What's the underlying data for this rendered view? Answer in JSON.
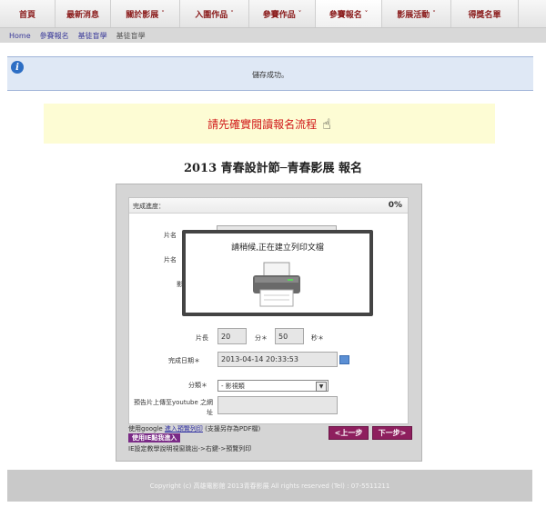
{
  "nav": {
    "items": [
      {
        "label": "首頁",
        "caret": ""
      },
      {
        "label": "最新消息",
        "caret": ""
      },
      {
        "label": "關於影展",
        "caret": "˅"
      },
      {
        "label": "入圍作品",
        "caret": "˅"
      },
      {
        "label": "參賽作品",
        "caret": "˅"
      },
      {
        "label": "參賽報名",
        "caret": "˅"
      },
      {
        "label": "影展活動",
        "caret": "˅"
      },
      {
        "label": "得獎名單",
        "caret": ""
      }
    ]
  },
  "subnav": {
    "items": [
      "Home",
      "參賽報名",
      "基徒盲學",
      "基徒盲學"
    ]
  },
  "info": {
    "icon": "info-icon",
    "message": "儲存成功。"
  },
  "notice": {
    "text": "請先確實閱讀報名流程"
  },
  "page_title": "2013 青春設計節─青春影展 報名",
  "form": {
    "progress_label": "完成進度：",
    "progress_value": "0%",
    "labels": {
      "name1": "片名",
      "name2": "片名",
      "frag": "影",
      "length": "片長",
      "minutes": "分＊",
      "seconds": "秒＊",
      "date": "完成日期＊",
      "category": "分類＊",
      "youtube": "預告片上傳至youtube 之網址"
    },
    "values": {
      "minutes": "20",
      "seconds": "50",
      "date": "2013-04-14 20:33:53",
      "category": "- 影視類"
    },
    "buttons": {
      "prev": "<上一步",
      "next": "下一步>"
    },
    "notes": {
      "google_prefix": "使用google ",
      "google_link": "進入預覽列印",
      "google_suffix": " (支援另存為PDF檔)",
      "ie_tag": "使用IE點我進入",
      "ie_note": "IE設定教學說明視窗跳出->右鍵->預覽列印"
    }
  },
  "modal": {
    "text": "請稍候,正在建立列印文檔",
    "icon": "printer-icon"
  },
  "footer": {
    "text": "Copyright (c) 高雄電影館 2013青春影展 All rights reserved (Tel) : 07-5511211"
  }
}
